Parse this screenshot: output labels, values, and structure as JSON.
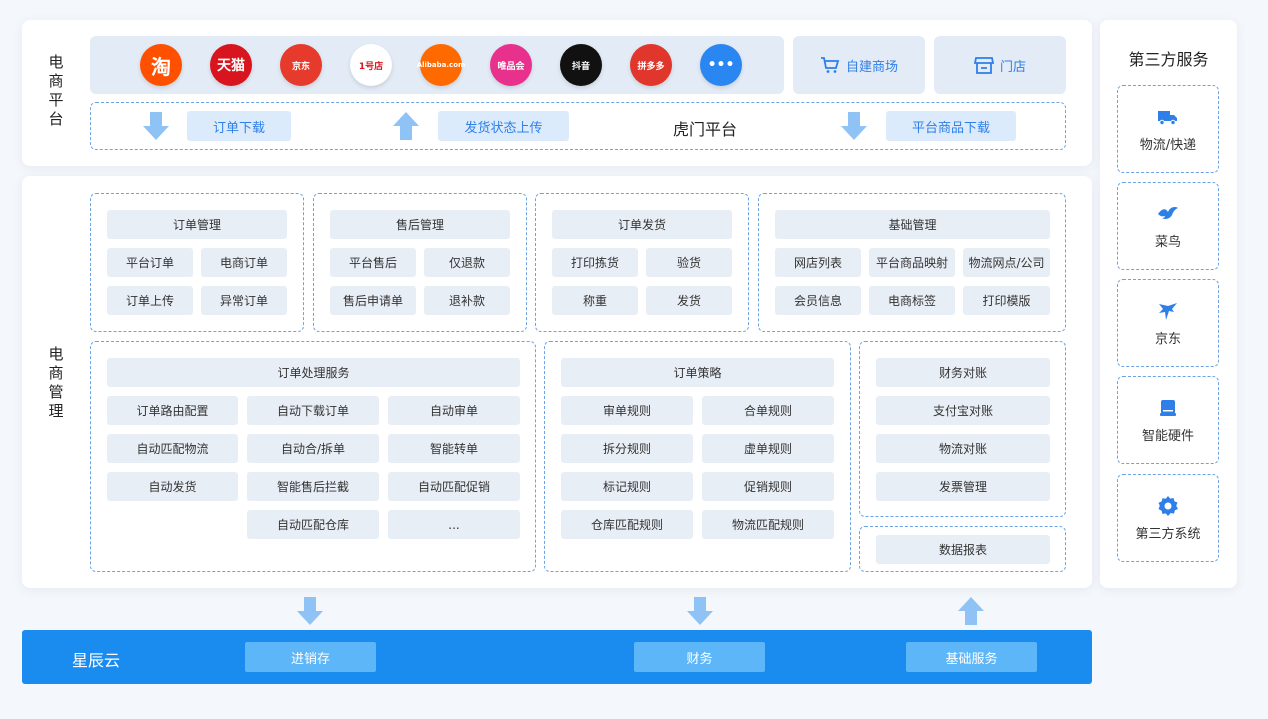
{
  "top": {
    "label": "电商平台",
    "logos": [
      {
        "text": "淘",
        "color": "#ff5000"
      },
      {
        "text": "天猫",
        "color": "#d8141f"
      },
      {
        "text": "京东",
        "color": "#e53a2c"
      },
      {
        "text": "1号店",
        "color": "#ffffff"
      },
      {
        "text": "Alibaba.com",
        "color": "#ff6a00"
      },
      {
        "text": "唯品会",
        "color": "#e8318c"
      },
      {
        "text": "抖音",
        "color": "#111111"
      },
      {
        "text": "拼多多",
        "color": "#e0362b"
      },
      {
        "text": "•••",
        "color": "#2a86f0"
      }
    ],
    "self_mall": "自建商场",
    "store": "门店",
    "flow": {
      "order_download": "订单下载",
      "ship_upload": "发货状态上传",
      "center": "虎门平台",
      "goods_download": "平台商品下载"
    }
  },
  "main": {
    "label": "电商管理",
    "order_mgmt": {
      "title": "订单管理",
      "items": [
        "平台订单",
        "电商订单",
        "订单上传",
        "异常订单"
      ]
    },
    "after_sale": {
      "title": "售后管理",
      "items": [
        "平台售后",
        "仅退款",
        "售后申请单",
        "退补款"
      ]
    },
    "ship": {
      "title": "订单发货",
      "items": [
        "打印拣货",
        "验货",
        "称重",
        "发货"
      ]
    },
    "basic": {
      "title": "基础管理",
      "items": [
        "网店列表",
        "平台商品映射",
        "物流网点/公司",
        "会员信息",
        "电商标签",
        "打印模版"
      ]
    },
    "process": {
      "title": "订单处理服务",
      "items": [
        "订单路由配置",
        "自动下载订单",
        "自动审单",
        "自动匹配物流",
        "自动合/拆单",
        "智能转单",
        "自动发货",
        "智能售后拦截",
        "自动匹配促销",
        "自动匹配仓库",
        "..."
      ]
    },
    "strategy": {
      "title": "订单策略",
      "items": [
        "审单规则",
        "合单规则",
        "拆分规则",
        "虚单规则",
        "标记规则",
        "促销规则",
        "仓库匹配规则",
        "物流匹配规则"
      ]
    },
    "finance": {
      "title": "财务对账",
      "items": [
        "支付宝对账",
        "物流对账",
        "发票管理"
      ]
    },
    "report": "数据报表"
  },
  "side": {
    "title": "第三方服务",
    "items": [
      {
        "label": "物流/快递",
        "icon": "truck-icon"
      },
      {
        "label": "菜鸟",
        "icon": "cainiao-bird-icon"
      },
      {
        "label": "京东",
        "icon": "jd-dog-icon"
      },
      {
        "label": "智能硬件",
        "icon": "hardware-device-icon"
      },
      {
        "label": "第三方系统",
        "icon": "gear-icon"
      }
    ]
  },
  "bottom": {
    "name": "星辰云",
    "items": [
      "进销存",
      "财务",
      "基础服务"
    ]
  },
  "colors": {
    "accent": "#2f7fe8",
    "bar": "#1a8cf0",
    "chip": "#e8eef6",
    "dash": "#6ba3e6"
  }
}
